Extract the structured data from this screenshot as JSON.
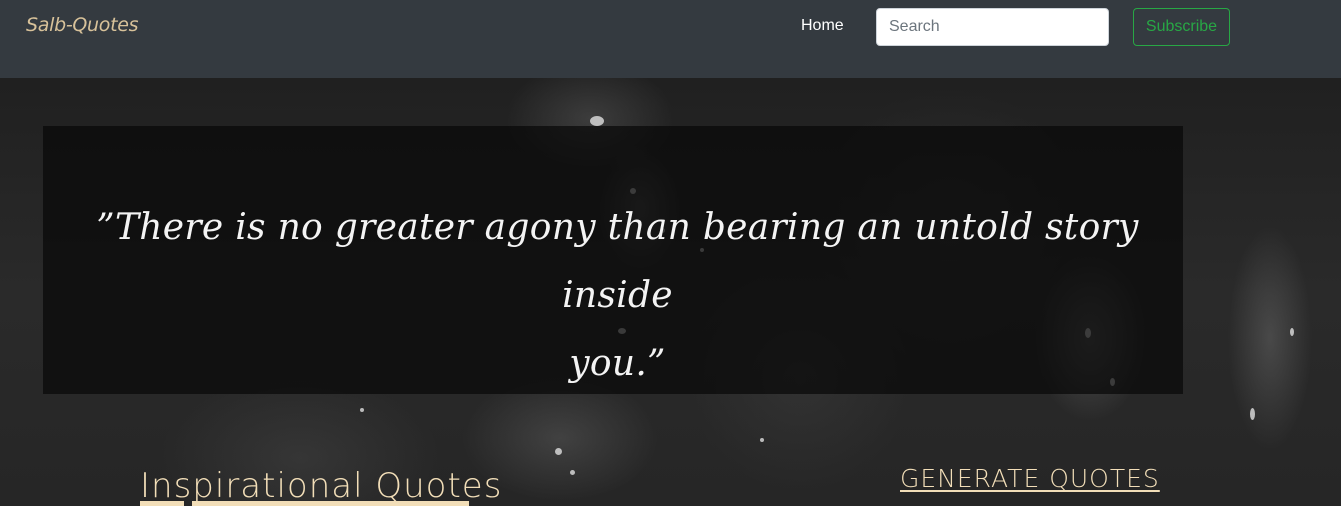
{
  "navbar": {
    "brand": "Salb-Quotes",
    "home_label": "Home",
    "search_placeholder": "Search",
    "search_value": "",
    "subscribe_label": "Subscribe"
  },
  "hero": {
    "quote_line1": "”There is no greater agony than bearing an untold story inside",
    "quote_line2": "you.”"
  },
  "section": {
    "title": "Inspirational Quotes",
    "generate_label": "GENERATE QUOTES"
  },
  "colors": {
    "navbar_bg": "#343a40",
    "brand": "#d8c29a",
    "accent_gold": "#f2deb8",
    "subscribe_green": "#28a745"
  }
}
